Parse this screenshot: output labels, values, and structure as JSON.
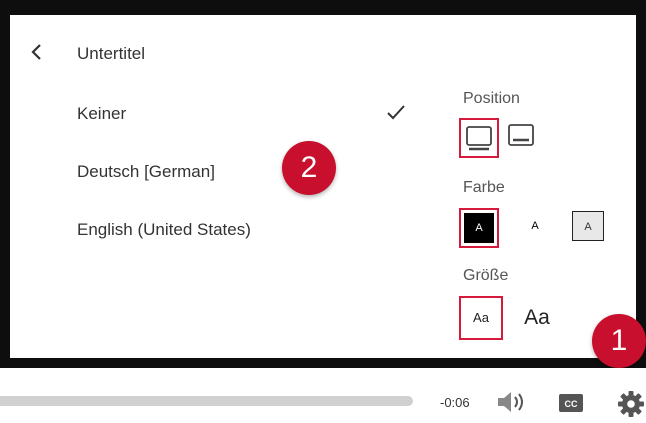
{
  "panel": {
    "title": "Untertitel",
    "languages": [
      "Keiner",
      "Deutsch [German]",
      "English (United States)"
    ],
    "selected_language": "Keiner"
  },
  "options": {
    "position_label": "Position",
    "color_label": "Farbe",
    "color_swatch_text": [
      "A",
      "A",
      "A"
    ],
    "size_label": "Größe",
    "size_small": "Aa",
    "size_large": "Aa"
  },
  "badges": {
    "one": "1",
    "two": "2"
  },
  "controls": {
    "time": "-0:06",
    "cc_label": "CC"
  },
  "colors": {
    "accent": "#d61a3c",
    "badge": "#c8102e"
  }
}
